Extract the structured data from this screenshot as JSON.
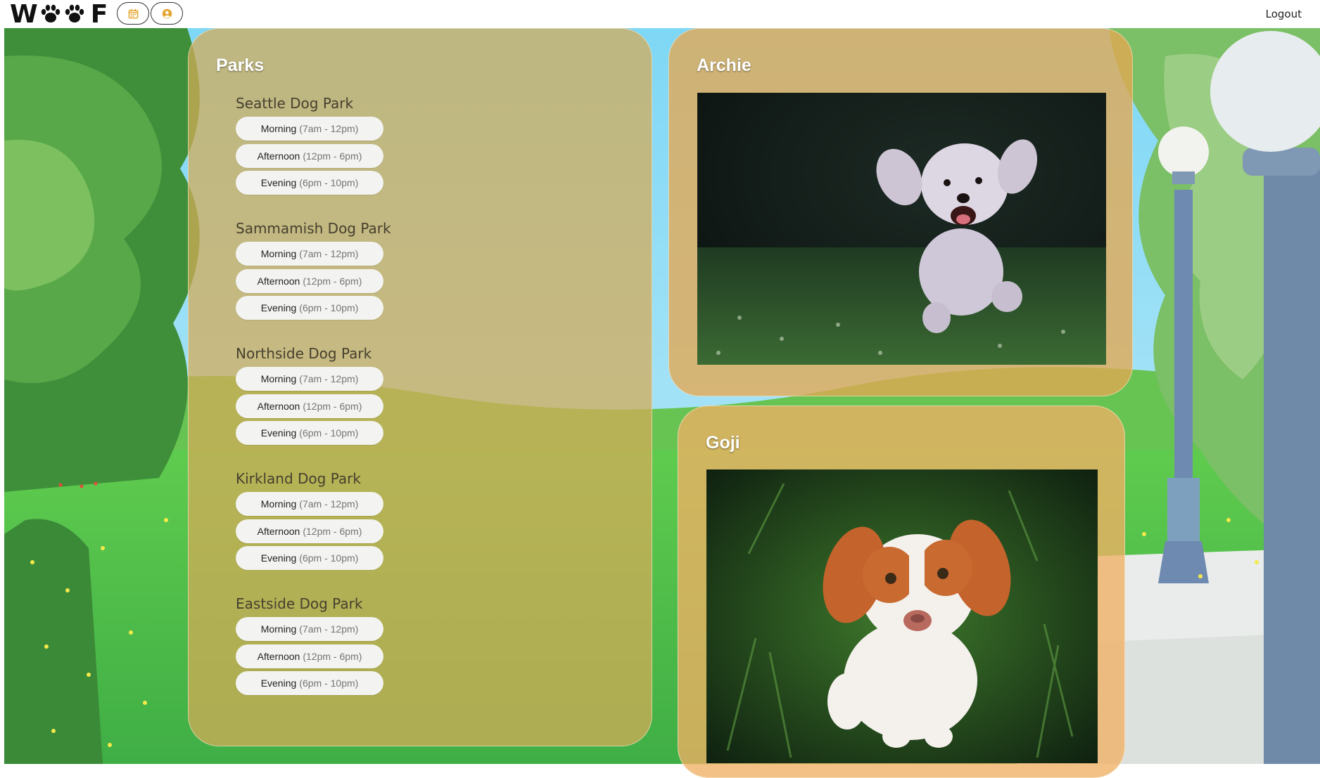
{
  "nav": {
    "logo_text": "WOOF",
    "calendar_icon": "calendar-icon",
    "profile_icon": "user-circle-icon",
    "logout_label": "Logout",
    "accent_color": "#e4a52e"
  },
  "parks_panel": {
    "title": "Parks",
    "parks": [
      {
        "name": "Seattle Dog Park",
        "slots": [
          {
            "label": "Morning",
            "time": "(7am - 12pm)"
          },
          {
            "label": "Afternoon",
            "time": "(12pm - 6pm)"
          },
          {
            "label": "Evening",
            "time": "(6pm - 10pm)"
          }
        ]
      },
      {
        "name": "Sammamish Dog Park",
        "slots": [
          {
            "label": "Morning",
            "time": "(7am - 12pm)"
          },
          {
            "label": "Afternoon",
            "time": "(12pm - 6pm)"
          },
          {
            "label": "Evening",
            "time": "(6pm - 10pm)"
          }
        ]
      },
      {
        "name": "Northside Dog Park",
        "slots": [
          {
            "label": "Morning",
            "time": "(7am - 12pm)"
          },
          {
            "label": "Afternoon",
            "time": "(12pm - 6pm)"
          },
          {
            "label": "Evening",
            "time": "(6pm - 10pm)"
          }
        ]
      },
      {
        "name": "Kirkland Dog Park",
        "slots": [
          {
            "label": "Morning",
            "time": "(7am - 12pm)"
          },
          {
            "label": "Afternoon",
            "time": "(12pm - 6pm)"
          },
          {
            "label": "Evening",
            "time": "(6pm - 10pm)"
          }
        ]
      },
      {
        "name": "Eastside Dog Park",
        "slots": [
          {
            "label": "Morning",
            "time": "(7am - 12pm)"
          },
          {
            "label": "Afternoon",
            "time": "(12pm - 6pm)"
          },
          {
            "label": "Evening",
            "time": "(6pm - 10pm)"
          }
        ]
      }
    ]
  },
  "dogs": [
    {
      "name": "Archie"
    },
    {
      "name": "Goji"
    }
  ]
}
